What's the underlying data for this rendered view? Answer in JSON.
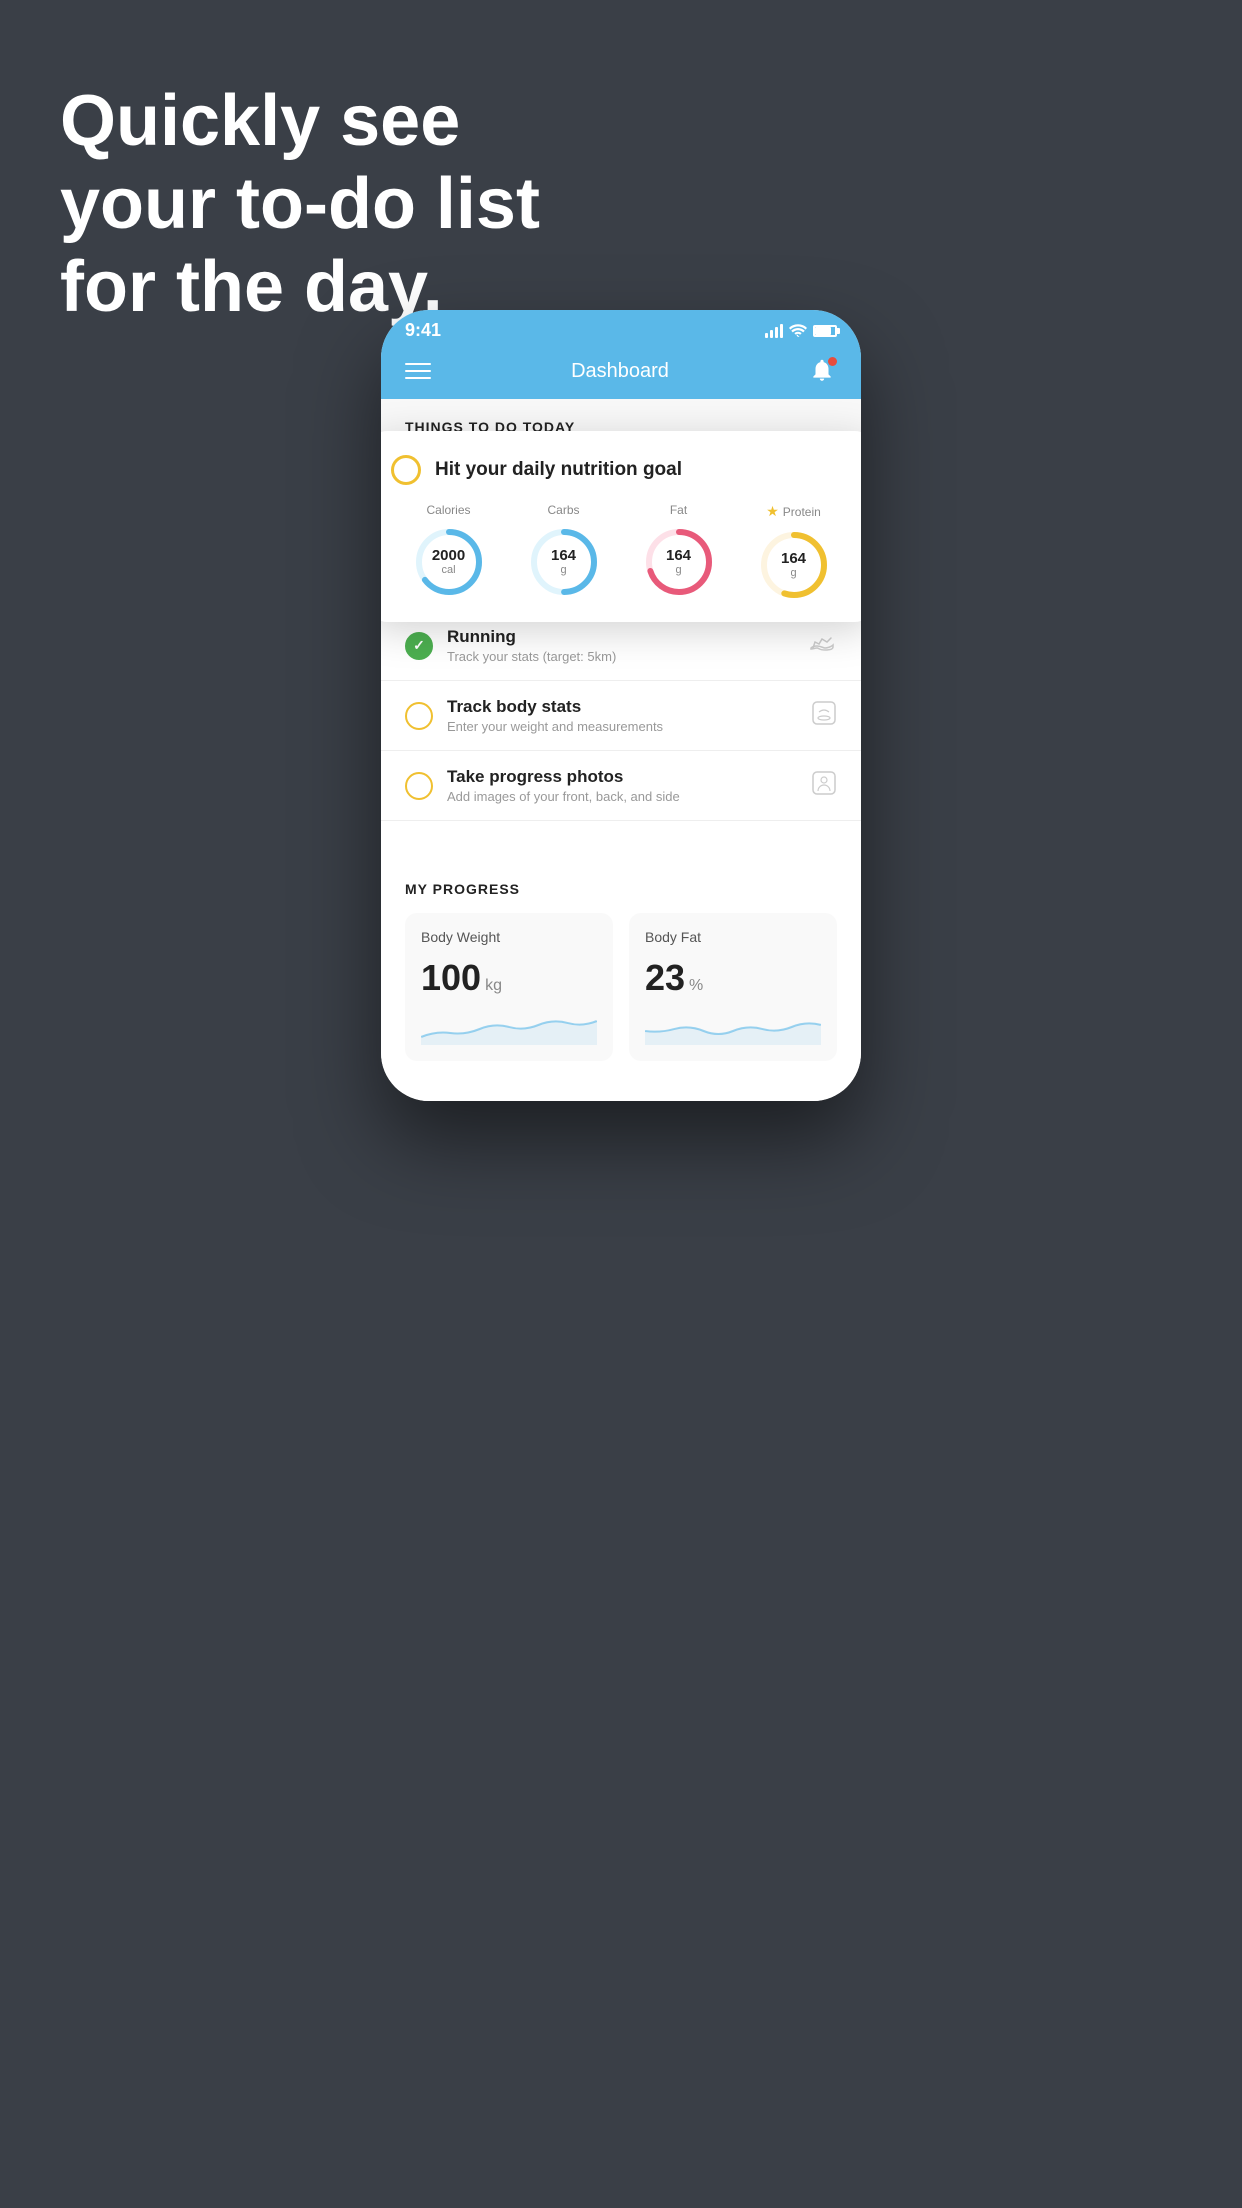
{
  "hero": {
    "line1": "Quickly see",
    "line2": "your to-do list",
    "line3": "for the day."
  },
  "phone": {
    "statusBar": {
      "time": "9:41"
    },
    "navBar": {
      "title": "Dashboard"
    },
    "sectionHeader": {
      "text": "THINGS TO DO TODAY"
    },
    "floatingCard": {
      "title": "Hit your daily nutrition goal",
      "nutrition": [
        {
          "label": "Calories",
          "value": "2000",
          "unit": "cal",
          "color": "#5ab8e8",
          "trackColor": "#e0f4fc",
          "percent": 65,
          "starred": false
        },
        {
          "label": "Carbs",
          "value": "164",
          "unit": "g",
          "color": "#5ab8e8",
          "trackColor": "#e0f4fc",
          "percent": 50,
          "starred": false
        },
        {
          "label": "Fat",
          "value": "164",
          "unit": "g",
          "color": "#e85a7a",
          "trackColor": "#fde0e8",
          "percent": 70,
          "starred": false
        },
        {
          "label": "Protein",
          "value": "164",
          "unit": "g",
          "color": "#f0c030",
          "trackColor": "#fdf4e0",
          "percent": 55,
          "starred": true
        }
      ]
    },
    "todoItems": [
      {
        "id": "running",
        "title": "Running",
        "subtitle": "Track your stats (target: 5km)",
        "circleColor": "green",
        "iconType": "shoe"
      },
      {
        "id": "body-stats",
        "title": "Track body stats",
        "subtitle": "Enter your weight and measurements",
        "circleColor": "yellow",
        "iconType": "scale"
      },
      {
        "id": "progress-photos",
        "title": "Take progress photos",
        "subtitle": "Add images of your front, back, and side",
        "circleColor": "yellow",
        "iconType": "person"
      }
    ],
    "progress": {
      "sectionTitle": "MY PROGRESS",
      "cards": [
        {
          "title": "Body Weight",
          "value": "100",
          "unit": "kg"
        },
        {
          "title": "Body Fat",
          "value": "23",
          "unit": "%"
        }
      ]
    }
  }
}
